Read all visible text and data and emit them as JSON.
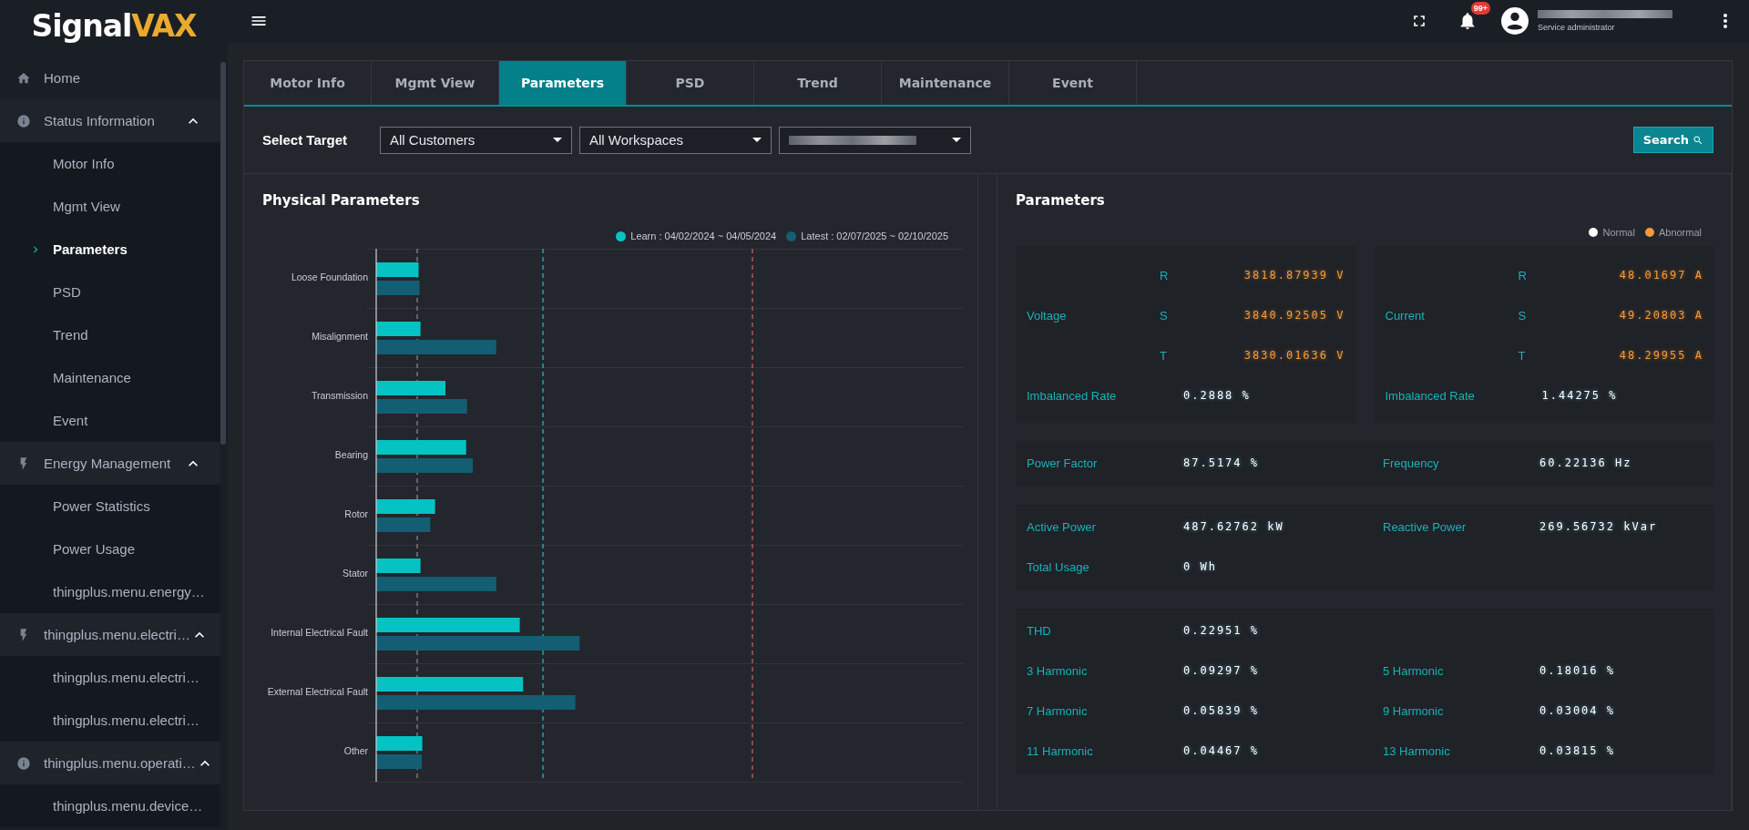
{
  "brand": {
    "first": "Signal",
    "second": "VAX"
  },
  "topbar": {
    "notification_count": "99+",
    "role": "Service administrator"
  },
  "sidebar": {
    "items": [
      {
        "label": "Home"
      },
      {
        "label": "Status Information",
        "expanded": true,
        "children": [
          {
            "label": "Motor Info",
            "selected": false
          },
          {
            "label": "Mgmt View",
            "selected": false
          },
          {
            "label": "Parameters",
            "selected": true
          },
          {
            "label": "PSD",
            "selected": false
          },
          {
            "label": "Trend",
            "selected": false
          },
          {
            "label": "Maintenance",
            "selected": false
          },
          {
            "label": "Event",
            "selected": false
          }
        ]
      },
      {
        "label": "Energy Management",
        "expanded": true,
        "children": [
          {
            "label": "Power Statistics",
            "selected": false
          },
          {
            "label": "Power Usage",
            "selected": false
          },
          {
            "label": "thingplus.menu.energy…",
            "selected": false
          }
        ]
      },
      {
        "label": "thingplus.menu.electri…",
        "expanded": true,
        "children": [
          {
            "label": "thingplus.menu.electri…",
            "selected": false
          },
          {
            "label": "thingplus.menu.electri…",
            "selected": false
          }
        ]
      },
      {
        "label": "thingplus.menu.operati…",
        "expanded": true,
        "children": [
          {
            "label": "thingplus.menu.device…",
            "selected": false
          }
        ]
      }
    ]
  },
  "tabs": [
    {
      "label": "Motor Info",
      "selected": false
    },
    {
      "label": "Mgmt View",
      "selected": false
    },
    {
      "label": "Parameters",
      "selected": true
    },
    {
      "label": "PSD",
      "selected": false
    },
    {
      "label": "Trend",
      "selected": false
    },
    {
      "label": "Maintenance",
      "selected": false
    },
    {
      "label": "Event",
      "selected": false
    }
  ],
  "filter": {
    "label": "Select Target",
    "dropdowns": [
      {
        "kind": "text",
        "value": "All Customers"
      },
      {
        "kind": "text",
        "value": "All Workspaces"
      },
      {
        "kind": "blurred"
      }
    ],
    "search_button": "Search"
  },
  "physical_parameters": {
    "title": "Physical Parameters",
    "legend": [
      {
        "label": "Learn : 04/02/2024 ~ 04/05/2024",
        "color": "#05c3c3"
      },
      {
        "label": "Latest : 02/07/2025 ~ 02/10/2025",
        "color": "#135e72"
      }
    ],
    "categories": [
      "Loose Foundation",
      "Misalignment",
      "Transmission",
      "Bearing",
      "Rotor",
      "Stator",
      "Internal Electrical Fault",
      "External Electrical Fault",
      "Other"
    ]
  },
  "parameters": {
    "title": "Parameters",
    "legend": [
      {
        "label": "Normal",
        "color": "#ffffff"
      },
      {
        "label": "Abnormal",
        "color": "#f59a3c"
      }
    ],
    "sections": [
      {
        "kind": "phase",
        "columns": [
          {
            "label": "Voltage",
            "phases": [
              {
                "phase": "R",
                "value": "3818.87939 V",
                "abnormal": true
              },
              {
                "phase": "S",
                "value": "3840.92505 V",
                "abnormal": true
              },
              {
                "phase": "T",
                "value": "3830.01636 V",
                "abnormal": true
              }
            ],
            "imbalance": {
              "label": "Imbalanced Rate",
              "value": "0.2888 %",
              "abnormal": false
            }
          },
          {
            "label": "Current",
            "phases": [
              {
                "phase": "R",
                "value": "48.01697 A",
                "abnormal": true
              },
              {
                "phase": "S",
                "value": "49.20803 A",
                "abnormal": true
              },
              {
                "phase": "T",
                "value": "48.29955 A",
                "abnormal": true
              }
            ],
            "imbalance": {
              "label": "Imbalanced Rate",
              "value": "1.44275 %",
              "abnormal": false
            }
          }
        ]
      },
      {
        "kind": "grid",
        "rows": [
          [
            {
              "label": "Power Factor",
              "value": "87.5174 %",
              "abnormal": false
            },
            {
              "label": "Frequency",
              "value": "60.22136 Hz",
              "abnormal": false
            }
          ]
        ]
      },
      {
        "kind": "grid",
        "rows": [
          [
            {
              "label": "Active Power",
              "value": "487.62762 kW",
              "abnormal": false
            },
            {
              "label": "Reactive Power",
              "value": "269.56732 kVar",
              "abnormal": false
            }
          ],
          [
            {
              "label": "Total Usage",
              "value": "0 Wh",
              "abnormal": false
            }
          ]
        ]
      },
      {
        "kind": "grid",
        "rows": [
          [
            {
              "label": "THD",
              "value": "0.22951 %",
              "abnormal": false
            }
          ],
          [
            {
              "label": "3 Harmonic",
              "value": "0.09297 %",
              "abnormal": false
            },
            {
              "label": "5 Harmonic",
              "value": "0.18016 %",
              "abnormal": false
            }
          ],
          [
            {
              "label": "7 Harmonic",
              "value": "0.05839 %",
              "abnormal": false
            },
            {
              "label": "9 Harmonic",
              "value": "0.03004 %",
              "abnormal": false
            }
          ],
          [
            {
              "label": "11 Harmonic",
              "value": "0.04467 %",
              "abnormal": false
            },
            {
              "label": "13 Harmonic",
              "value": "0.03815 %",
              "abnormal": false
            }
          ]
        ]
      }
    ]
  }
}
